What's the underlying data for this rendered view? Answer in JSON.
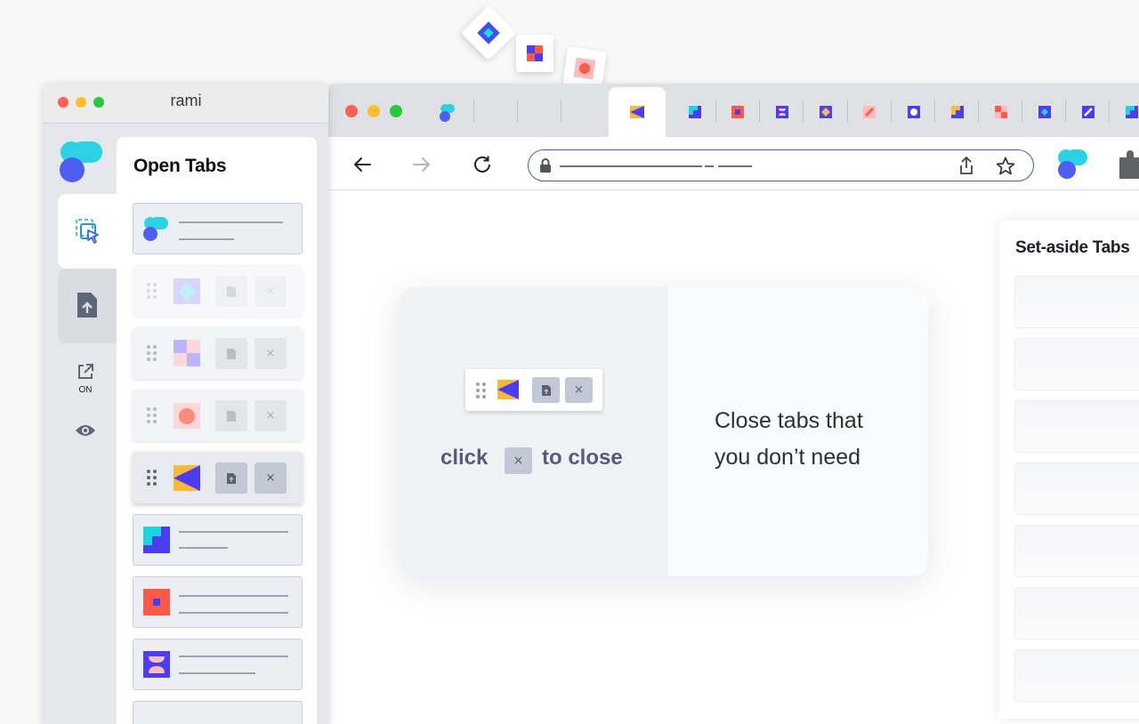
{
  "app_window": {
    "title": "rami",
    "sidebar": {
      "items": [
        {
          "icon": "select-tabs-icon",
          "active": true
        },
        {
          "icon": "upload-file-icon",
          "active": false
        },
        {
          "icon": "open-external-icon",
          "label": "ON"
        },
        {
          "icon": "eye-icon"
        }
      ]
    },
    "open_tabs": {
      "title": "Open Tabs",
      "rows": [
        {
          "favicon": "app-logo",
          "state": "plain"
        },
        {
          "favicon": "diamond",
          "state": "faint"
        },
        {
          "favicon": "checker",
          "state": "hover"
        },
        {
          "favicon": "circle",
          "state": "hover"
        },
        {
          "favicon": "arrow",
          "state": "active"
        },
        {
          "favicon": "steps",
          "state": "plain"
        },
        {
          "favicon": "square",
          "state": "plain"
        },
        {
          "favicon": "bowl",
          "state": "plain"
        }
      ]
    }
  },
  "browser": {
    "tab_favicons": [
      "steps",
      "square",
      "bowl",
      "diamond",
      "pencil",
      "circle",
      "steps",
      "checker",
      "diamond",
      "pencil",
      "steps"
    ]
  },
  "tutorial": {
    "caption": "Close tabs that you don’t need",
    "hint_prefix": "click",
    "hint_button": "×",
    "hint_suffix": "to close",
    "mini_close": "×"
  },
  "set_aside": {
    "title": "Set-aside Tabs"
  },
  "colors": {
    "accent": "#4a57c9",
    "teal": "#1ad5e0",
    "blue": "#4d3df2",
    "red": "#fb5a48",
    "yellow": "#f6b93b",
    "pink": "#fbbcc0"
  }
}
